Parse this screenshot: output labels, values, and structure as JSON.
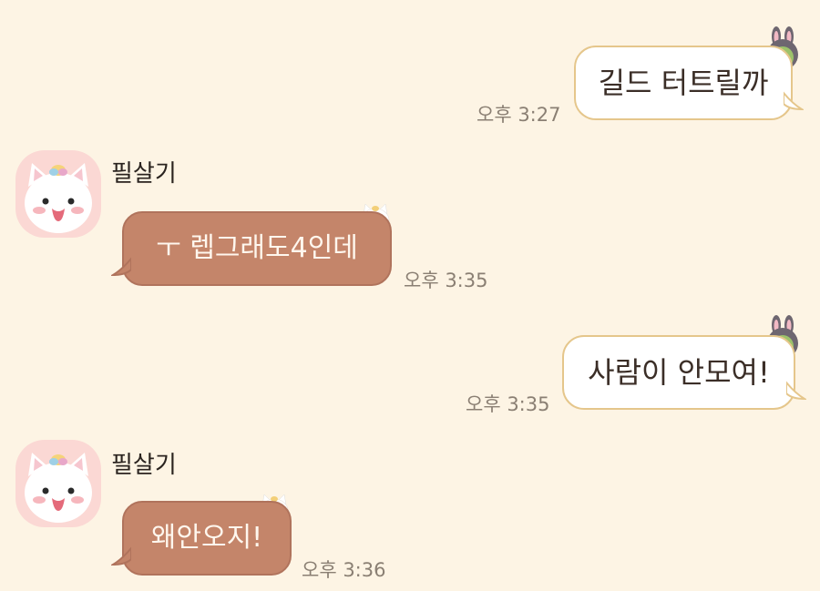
{
  "messages": [
    {
      "direction": "outgoing",
      "text": "길드 터트릴까",
      "time": "오후 3:27",
      "sticker_icon": "bunny-hat-frog-icon"
    },
    {
      "direction": "incoming",
      "sender": "필살기",
      "text": "ㅜ 렙그래도4인데",
      "time": "오후 3:35",
      "sticker_icon": "unicorn-cat-icon"
    },
    {
      "direction": "outgoing",
      "text": "사람이 안모여!",
      "time": "오후 3:35",
      "sticker_icon": "bunny-hat-frog-icon"
    },
    {
      "direction": "incoming",
      "sender": "필살기",
      "text": "왜안오지!",
      "time": "오후 3:36",
      "sticker_icon": "unicorn-cat-icon"
    }
  ],
  "colors": {
    "background": "#fdf4e4",
    "outgoing_bubble": "#ffffff",
    "outgoing_border": "#e5c68b",
    "incoming_bubble": "#c4856a",
    "time_text": "#8a7f73"
  }
}
